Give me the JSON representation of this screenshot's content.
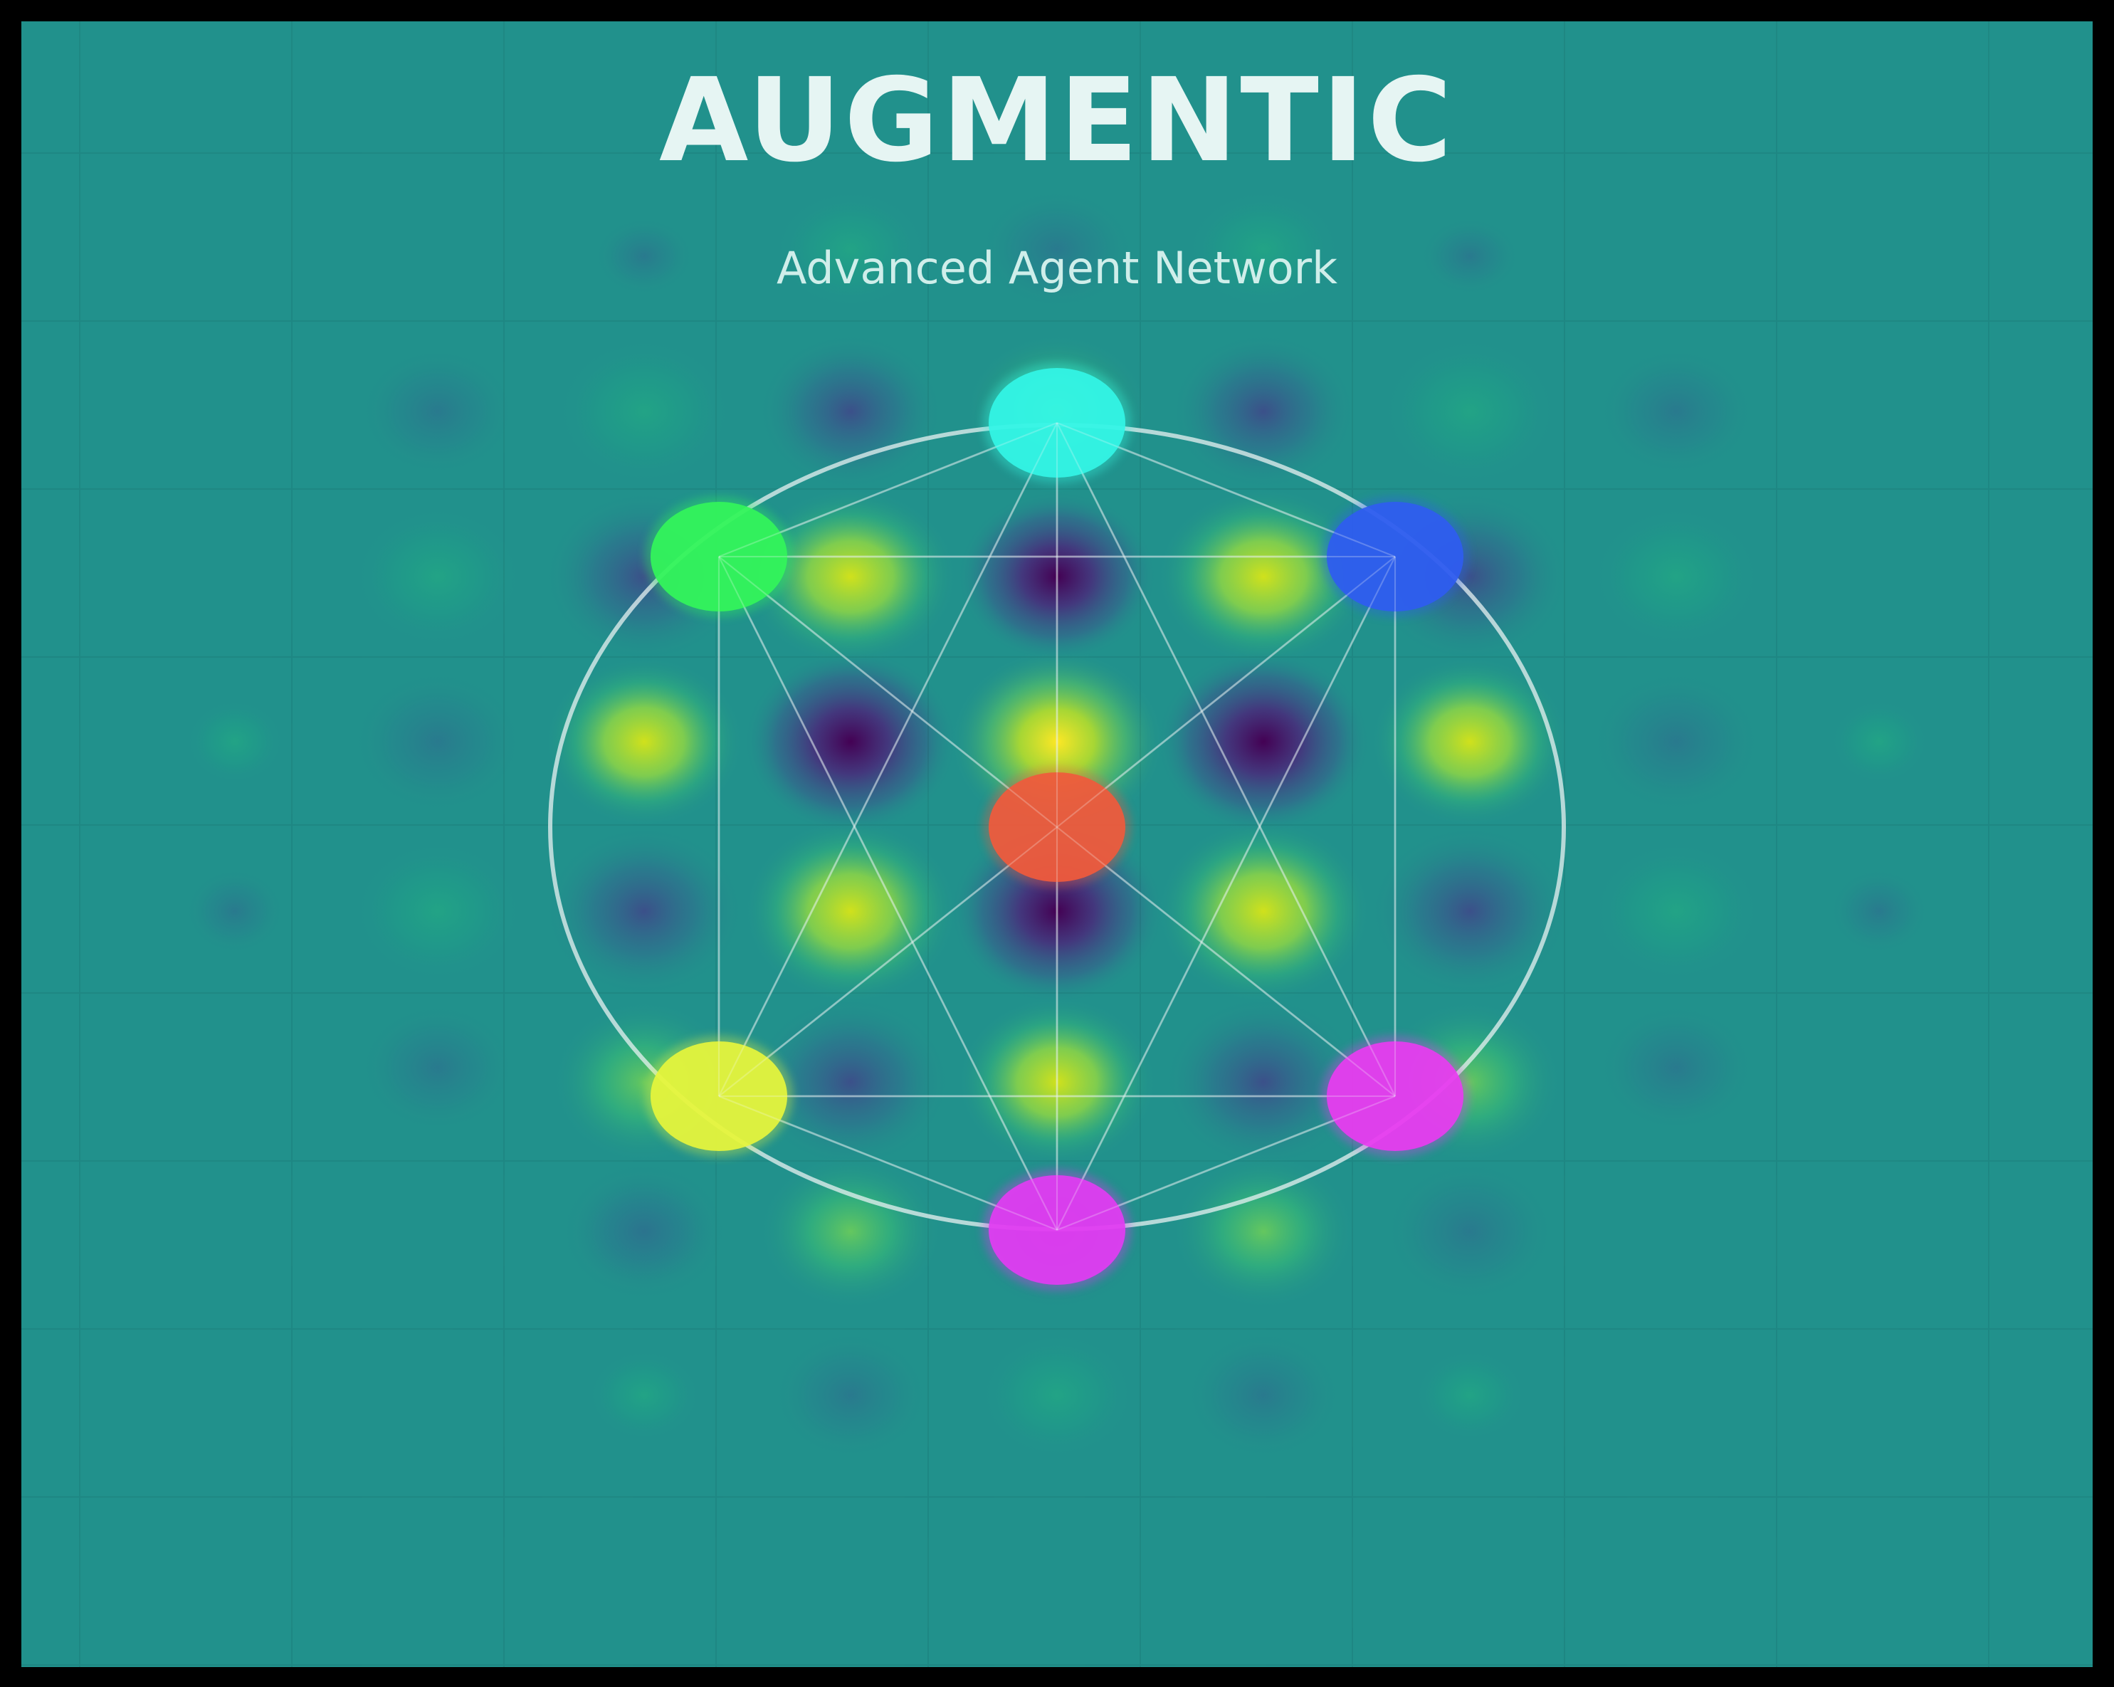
{
  "title": "AUGMENTIC",
  "subtitle": "Advanced Agent Network",
  "colors": {
    "frame": "#000000",
    "background": "#21918c",
    "title": "#e6f5f3",
    "subtitle": "#cfeeea",
    "ring": "#e8f2f2",
    "links": "#e8f2f2"
  },
  "nodes": [
    {
      "name": "node-top",
      "color": "#33f5e6"
    },
    {
      "name": "node-upper-left",
      "color": "#33f55a"
    },
    {
      "name": "node-upper-right",
      "color": "#2f5cf0"
    },
    {
      "name": "node-center",
      "color": "#f05a3c"
    },
    {
      "name": "node-lower-left",
      "color": "#e6f53c"
    },
    {
      "name": "node-lower-right",
      "color": "#e83cf0"
    },
    {
      "name": "node-bottom",
      "color": "#e23cf2"
    }
  ],
  "links": [
    [
      "node-top",
      "node-upper-left"
    ],
    [
      "node-top",
      "node-upper-right"
    ],
    [
      "node-top",
      "node-bottom"
    ],
    [
      "node-top",
      "node-lower-left"
    ],
    [
      "node-top",
      "node-lower-right"
    ],
    [
      "node-upper-left",
      "node-upper-right"
    ],
    [
      "node-upper-left",
      "node-lower-left"
    ],
    [
      "node-upper-left",
      "node-center"
    ],
    [
      "node-upper-left",
      "node-bottom"
    ],
    [
      "node-upper-right",
      "node-lower-right"
    ],
    [
      "node-upper-right",
      "node-center"
    ],
    [
      "node-upper-right",
      "node-bottom"
    ],
    [
      "node-lower-left",
      "node-lower-right"
    ],
    [
      "node-lower-left",
      "node-center"
    ],
    [
      "node-lower-left",
      "node-bottom"
    ],
    [
      "node-lower-right",
      "node-center"
    ],
    [
      "node-lower-right",
      "node-bottom"
    ]
  ]
}
